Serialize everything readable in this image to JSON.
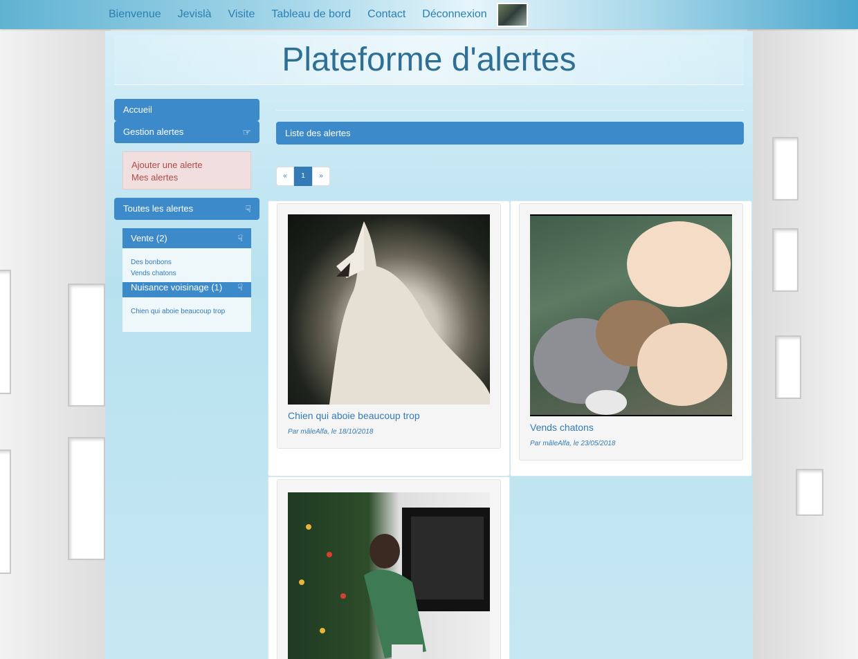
{
  "nav": {
    "items": [
      "Bienvenue",
      "Jevislà",
      "Visite",
      "Tableau de bord",
      "Contact",
      "Déconnexion"
    ]
  },
  "header": {
    "title": "Plateforme d'alertes"
  },
  "sidebar": {
    "accueil": "Accueil",
    "gestion": "Gestion alertes",
    "submenu": [
      "Ajouter une alerte",
      "Mes alertes"
    ],
    "toutes": "Toutes les alertes",
    "categories": [
      {
        "label": "Vente (2)",
        "items": [
          "Des bonbons",
          "Vends chatons"
        ]
      },
      {
        "label": "Nuisance voisinage (1)",
        "items": [
          "Chien qui aboie beaucoup trop"
        ]
      }
    ]
  },
  "main": {
    "list_title": "Liste des alertes",
    "pagination": [
      "«",
      "1",
      "»"
    ],
    "cards": [
      {
        "title": "Chien qui aboie beaucoup trop",
        "meta": "Par mâleAlfa, le 18/10/2018",
        "image": "howling-wolf"
      },
      {
        "title": "Vends chatons",
        "meta": "Par mâleAlfa, le 23/05/2018",
        "image": "kittens"
      },
      {
        "title": "",
        "meta": "",
        "image": "boy-christmas-tree"
      }
    ]
  }
}
